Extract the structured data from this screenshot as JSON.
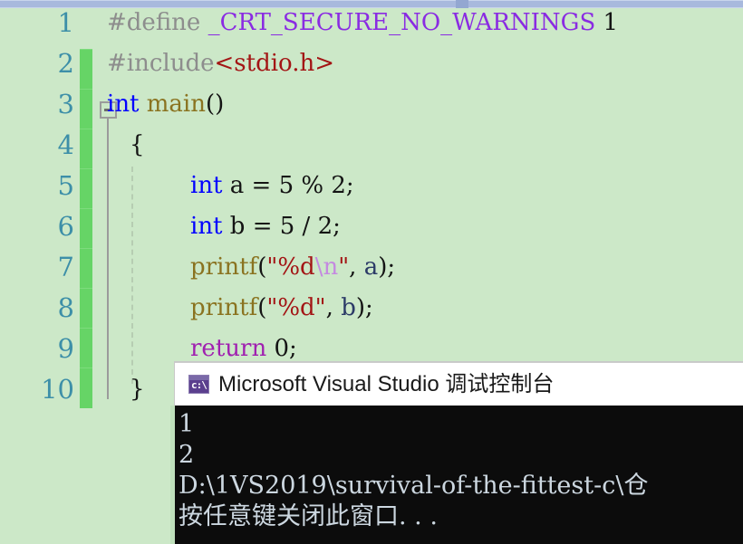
{
  "editor": {
    "theme_background": "#cce8c8",
    "line_numbers": [
      "1",
      "2",
      "3",
      "4",
      "5",
      "6",
      "7",
      "8",
      "9",
      "10"
    ],
    "fold_marker": "collapse-minus",
    "lines": [
      {
        "n": 1,
        "indent": 0,
        "tokens": [
          {
            "t": "#define ",
            "c": "c-pre"
          },
          {
            "t": "_CRT_SECURE_NO_WARNINGS",
            "c": "c-macro"
          },
          {
            "t": " ",
            "c": "c-plain"
          },
          {
            "t": "1",
            "c": "c-num"
          }
        ]
      },
      {
        "n": 2,
        "indent": 0,
        "tokens": [
          {
            "t": "#include",
            "c": "c-pre"
          },
          {
            "t": "<stdio.h>",
            "c": "c-str"
          }
        ]
      },
      {
        "n": 3,
        "indent": 0,
        "tokens": [
          {
            "t": "int",
            "c": "c-kw"
          },
          {
            "t": " ",
            "c": "c-plain"
          },
          {
            "t": "main",
            "c": "c-fn"
          },
          {
            "t": "()",
            "c": "c-brace"
          }
        ]
      },
      {
        "n": 4,
        "indent": 1,
        "tokens": [
          {
            "t": "{",
            "c": "c-brace"
          }
        ]
      },
      {
        "n": 5,
        "indent": 2,
        "tokens": [
          {
            "t": "int",
            "c": "c-kw"
          },
          {
            "t": " a = 5 % 2;",
            "c": "c-plain"
          }
        ]
      },
      {
        "n": 6,
        "indent": 2,
        "tokens": [
          {
            "t": "int",
            "c": "c-kw"
          },
          {
            "t": " b = 5 / 2;",
            "c": "c-plain"
          }
        ]
      },
      {
        "n": 7,
        "indent": 2,
        "tokens": [
          {
            "t": "printf",
            "c": "c-fn"
          },
          {
            "t": "(",
            "c": "c-brace"
          },
          {
            "t": "\"%d",
            "c": "c-str"
          },
          {
            "t": "\\n",
            "c": "c-esc"
          },
          {
            "t": "\"",
            "c": "c-str"
          },
          {
            "t": ", ",
            "c": "c-plain"
          },
          {
            "t": "a",
            "c": "c-var"
          },
          {
            "t": ");",
            "c": "c-brace"
          }
        ]
      },
      {
        "n": 8,
        "indent": 2,
        "tokens": [
          {
            "t": "printf",
            "c": "c-fn"
          },
          {
            "t": "(",
            "c": "c-brace"
          },
          {
            "t": "\"%d\"",
            "c": "c-str"
          },
          {
            "t": ", ",
            "c": "c-plain"
          },
          {
            "t": "b",
            "c": "c-var"
          },
          {
            "t": ");",
            "c": "c-brace"
          }
        ]
      },
      {
        "n": 9,
        "indent": 2,
        "tokens": [
          {
            "t": "return",
            "c": "c-kw2"
          },
          {
            "t": " 0;",
            "c": "c-plain"
          }
        ]
      },
      {
        "n": 10,
        "indent": 1,
        "tokens": [
          {
            "t": "}",
            "c": "c-brace"
          }
        ]
      }
    ]
  },
  "console": {
    "icon": "console-app-icon",
    "icon_text": "c:\\",
    "title": "Microsoft Visual Studio 调试控制台",
    "output_lines": [
      "1",
      "2",
      "D:\\1VS2019\\survival-of-the-fittest-c\\仓",
      "按任意键关闭此窗口. . ."
    ]
  },
  "scrollbar": {
    "orientation": "horizontal",
    "position": "top"
  }
}
